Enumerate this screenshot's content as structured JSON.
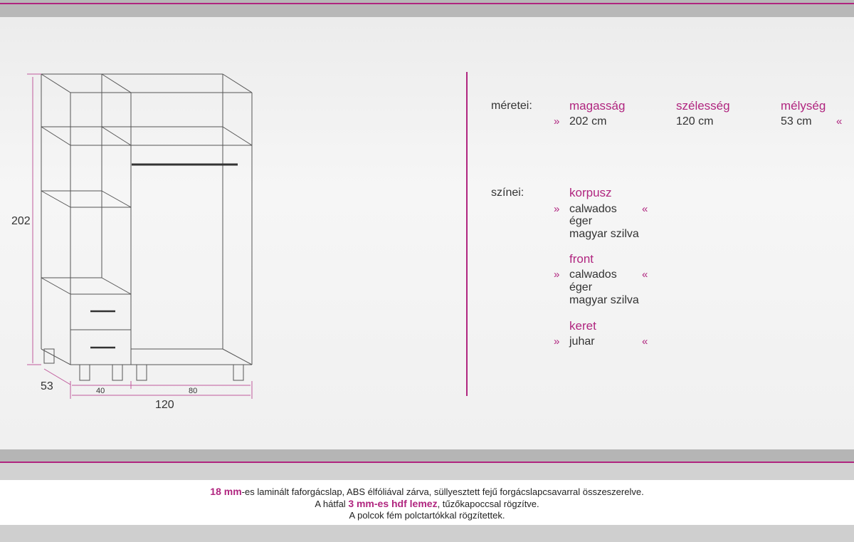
{
  "drawing": {
    "height_label": "202",
    "depth_label": "53",
    "left_width_label": "40",
    "right_width_label": "80",
    "total_width_label": "120"
  },
  "dimensions": {
    "label": "méretei:",
    "height": {
      "title": "magasság",
      "value": "202  cm"
    },
    "width": {
      "title": "szélesség",
      "value": "120  cm"
    },
    "depth": {
      "title": "mélység",
      "value": "53  cm"
    },
    "open_quote": "»",
    "close_quote": "«"
  },
  "colors_section": {
    "label": "színei:",
    "groups": [
      {
        "title": "korpusz",
        "options": [
          "calwados",
          "éger",
          "magyar szilva"
        ]
      },
      {
        "title": "front",
        "options": [
          "calwados",
          "éger",
          "magyar szilva"
        ]
      },
      {
        "title": "keret",
        "options": [
          "juhar"
        ]
      }
    ],
    "open_quote": "»",
    "close_quote": "«"
  },
  "footer": {
    "line1_bold": "18 mm",
    "line1_rest": "-es laminált faforgácslap, ABS élfóliával zárva, süllyesztett fejű forgácslapcsavarral összeszerelve.",
    "line2_start": "A hátfal ",
    "line2_bold": "3 mm-es hdf lemez",
    "line2_rest": ", tűzőkapoccsal rögzítve.",
    "line3": "A polcok fém polctartókkal rögzítettek."
  },
  "accent_color": "#b0257f"
}
